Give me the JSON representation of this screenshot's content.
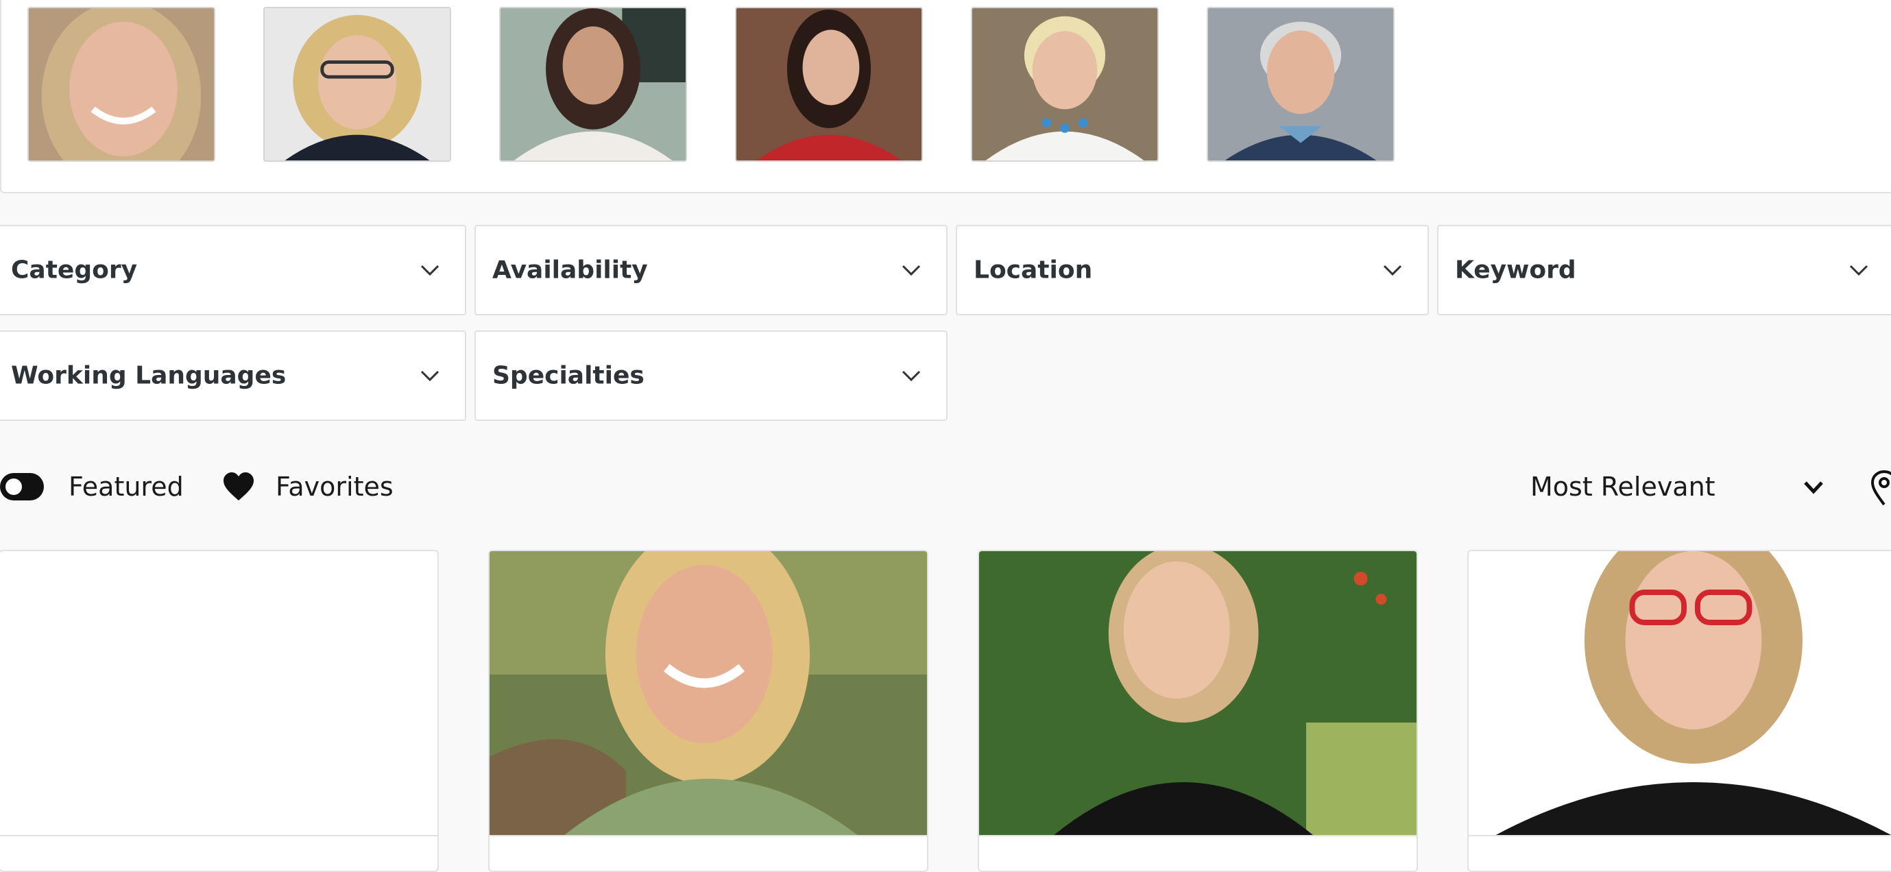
{
  "featured_strip": {
    "photos": [
      {
        "icon": "portrait-photo-woman-blonde"
      },
      {
        "icon": "portrait-photo-woman-glasses"
      },
      {
        "icon": "portrait-photo-woman-dark-hair"
      },
      {
        "icon": "portrait-photo-woman-red-jacket"
      },
      {
        "icon": "portrait-photo-woman-short-blonde"
      },
      {
        "icon": "portrait-photo-man-grey-beard"
      }
    ]
  },
  "filters": {
    "category": "Category",
    "availability": "Availability",
    "location": "Location",
    "keyword": "Keyword",
    "working_languages": "Working Languages",
    "specialties": "Specialties"
  },
  "toolbar": {
    "featured_label": "Featured",
    "favorites_label": "Favorites",
    "sort_value": "Most Relevant"
  },
  "cards": [
    {
      "icon": "empty-photo-placeholder"
    },
    {
      "icon": "portrait-photo-woman-green-shirt"
    },
    {
      "icon": "portrait-photo-woman-black-top"
    },
    {
      "icon": "portrait-photo-woman-red-glasses"
    }
  ],
  "colors": {
    "background": "#f9f9f9",
    "card": "#ffffff",
    "border": "#e2e2e2",
    "text": "#2e3338",
    "toggle": "#111111"
  }
}
